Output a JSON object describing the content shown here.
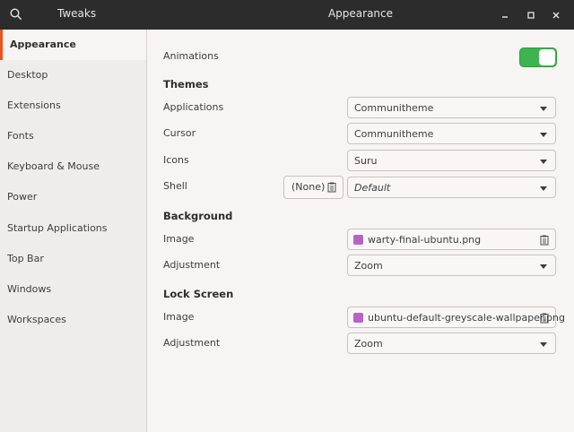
{
  "titlebar": {
    "app_name": "Tweaks",
    "title": "Appearance",
    "search_icon": "search-icon",
    "controls": [
      "minimize-icon",
      "maximize-icon",
      "close-icon"
    ]
  },
  "sidebar": {
    "items": [
      {
        "label": "Appearance",
        "active": true
      },
      {
        "label": "Desktop"
      },
      {
        "label": "Extensions"
      },
      {
        "label": "Fonts"
      },
      {
        "label": "Keyboard & Mouse"
      },
      {
        "label": "Power"
      },
      {
        "label": "Startup Applications"
      },
      {
        "label": "Top Bar"
      },
      {
        "label": "Windows"
      },
      {
        "label": "Workspaces"
      }
    ]
  },
  "main": {
    "animations": {
      "label": "Animations",
      "enabled": true
    },
    "themes": {
      "heading": "Themes",
      "applications": {
        "label": "Applications",
        "value": "Communitheme"
      },
      "cursor": {
        "label": "Cursor",
        "value": "Communitheme"
      },
      "icons": {
        "label": "Icons",
        "value": "Suru"
      },
      "shell": {
        "label": "Shell",
        "file_value": "(None)",
        "value": "Default"
      }
    },
    "background": {
      "heading": "Background",
      "image": {
        "label": "Image",
        "value": "warty-final-ubuntu.png"
      },
      "adjustment": {
        "label": "Adjustment",
        "value": "Zoom"
      }
    },
    "lock_screen": {
      "heading": "Lock Screen",
      "image": {
        "label": "Image",
        "value": "ubuntu-default-greyscale-wallpaper.png"
      },
      "adjustment": {
        "label": "Adjustment",
        "value": "Zoom"
      }
    }
  },
  "colors": {
    "titlebar": "#2c2c2c",
    "accent": "#e95420",
    "toggle_on": "#3eb34f",
    "file_icon": "#b962c6"
  }
}
